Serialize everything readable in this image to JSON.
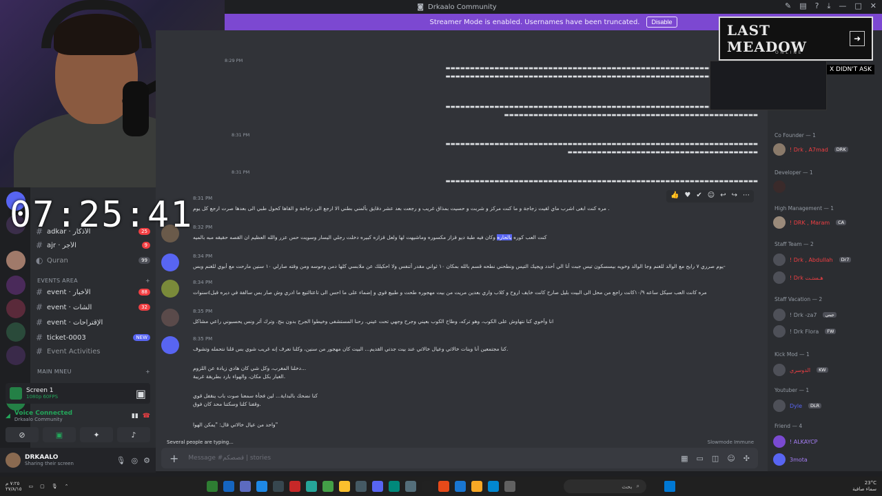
{
  "window": {
    "title": "Drkaalo Community"
  },
  "streamer_mode": {
    "message": "Streamer Mode is enabled. Usernames have been truncated.",
    "button": "Disable"
  },
  "clock_overlay": "07:25:41",
  "channels": {
    "items": [
      {
        "label": "adkar · الأذكار",
        "badge": "25"
      },
      {
        "label": "ajr · الأجر",
        "badge": "9"
      },
      {
        "label": "Quran",
        "badge": "99"
      }
    ],
    "category_events": "EVENTS AREA",
    "events": [
      {
        "label": "event · الأخبار",
        "badge": "88"
      },
      {
        "label": "event · الشات",
        "badge": "32"
      },
      {
        "label": "event · الإقتراحات",
        "badge": ""
      },
      {
        "label": "ticket-0003",
        "badge": "NEW"
      },
      {
        "label": "Event Activities",
        "badge": ""
      }
    ],
    "category_main": "MAIN MNEU"
  },
  "screen_share": {
    "title": "Screen 1",
    "sub": "1080p 60FPS"
  },
  "voice": {
    "status": "Voice Connected",
    "sub": "Drkaalo Community"
  },
  "user": {
    "name": "DRKAALO",
    "status": "Sharing their screen"
  },
  "chat": {
    "earlier_times": [
      "8:29 PM",
      "8:31 PM",
      "8:31 PM"
    ],
    "messages": [
      {
        "time": "8:31 PM",
        "body": "مره كنت ابغى اشرب ماي لقيت زجاجة و ما كنت مركز و شربت و حسيت بمذاق غريب و رجعت بعد عشر دقايق بألمني بطني الا ارجع الى زجاجة و القاها كحول طبي الى بعدها صرت ارجع كل يوم ."
      },
      {
        "time": "8:32 PM",
        "body": "كنت العب كوره بالحاره وكان فيه طبة ديو قزاز مكسوره وماشيهت لها ولعل قزازه كبيره دخلت رجلي اليسار وسويت حس عزر والله العظيم ان القصه حقيقه مبه بالميه",
        "highlight": "بالحاره"
      },
      {
        "time": "8:34 PM",
        "body": "يوم صرري ٧ رايح مع الوالد للغنم وجا الوالد وخويه بيسسكون تيس جبت أنا الي أحدد ويجيك التيس ونطحني نطحه قسم بالله بمكان ١٠ ثواني مقدر أتنفس ولا احكيلك عن ملابسي كلها دمن وحوسه ومن وقته صارلي ١٠ سنين مارحت مع أبوي للغنم وبس-"
      },
      {
        "time": "8:34 PM",
        "body": "مره كانت العب سيكل ساعه ١٠/٩كانت راجع من محل الى البيت بليل صارح كانت خايف اروح و كلاب واري بعدين مريت من بيت مهجوره طحت و طبيع قوي و إضماء على ما احس الى تاعتالتيع ما ادري وش صار بس سالفة في ديره قبل٤سنوات"
      },
      {
        "time": "8:35 PM",
        "body": "انا وأخوي كنا نتهاوش على الكوب، وهو تركه، وطاح الكوب بعيني وجرح وجهي تحت عيني. رحنا المستشفى وخيطوا الجرح بدون بنج. وترك أثر ونس يحسبوني راعي مشاكل"
      },
      {
        "time": "8:35 PM",
        "body": "كنا مجتمعين أنا وبنات خالاتي وعيال خالاتي عند بيت جدتي القديم... البيت كان مهجور من سنين، وكلنا نعرف إنه غريب شوي بس قلنا نتحمله وتشوف.",
        "extra": [
          "دخلنا المغرب، وكل شي كان هادي زيادة عن اللزوم...",
          "الغبار بكل مكان، والهواء بارد بطريقة غريبة.",
          "كنا نضحك بالبداية... لين فجأة سمعنا صوت باب ينقفل قوي",
          "وقفنا كلنا وسكتنا محد كان فوق.",
          "واحد من عيال خالاتي قال: \"يمكن الهوا\""
        ]
      }
    ],
    "typing": "Several people are typing...",
    "slowmode": "Slowmode Immune",
    "composer_placeholder": "Message #قصصكم | stories"
  },
  "members": {
    "groups": [
      {
        "head": "Co Founder — 1",
        "members": [
          {
            "name": "! Drk , A7mad",
            "tag": "DRK"
          }
        ]
      },
      {
        "head": "Developer — 1",
        "members": [
          {
            "name": "",
            "tag": ""
          }
        ]
      },
      {
        "head": "High Management — 1",
        "members": [
          {
            "name": "! DRK , Maram",
            "tag": "CA"
          }
        ]
      },
      {
        "head": "Staff Team — 2",
        "members": [
          {
            "name": "! Drk , Abdullah",
            "tag": "Dr7"
          },
          {
            "name": "! Drk هـستـت",
            "tag": ""
          }
        ]
      },
      {
        "head": "Staff Vacation — 2",
        "members": [
          {
            "name": "! Drk -za7",
            "tag": "جيني"
          },
          {
            "name": "! Drk Flora",
            "tag": "FW"
          }
        ]
      },
      {
        "head": "Kick Mod — 1",
        "members": [
          {
            "name": "الدوسري",
            "tag": "KW"
          }
        ]
      },
      {
        "head": "Youtuber — 1",
        "members": [
          {
            "name": "Dyle",
            "tag": "DLR"
          }
        ]
      },
      {
        "head": "Friend — 4",
        "members": [
          {
            "name": "! ALKAYCP",
            "tag": ""
          },
          {
            "name": "3mota",
            "tag": ""
          }
        ]
      }
    ]
  },
  "overlay": {
    "banner": "LAST MEADOW",
    "banner_sub": "ONLINE",
    "note": "X DIDN'T ASK"
  },
  "taskbar": {
    "search": "بحث",
    "temp": "23°C",
    "weather": "سماء صافية",
    "time": "٧:٢٥ م",
    "date": "٢٧/٨/١٥"
  },
  "colors": {
    "streamer_bar": "#7c48d1",
    "accent": "#5865f2",
    "danger": "#f23f43",
    "online": "#23a55a"
  }
}
